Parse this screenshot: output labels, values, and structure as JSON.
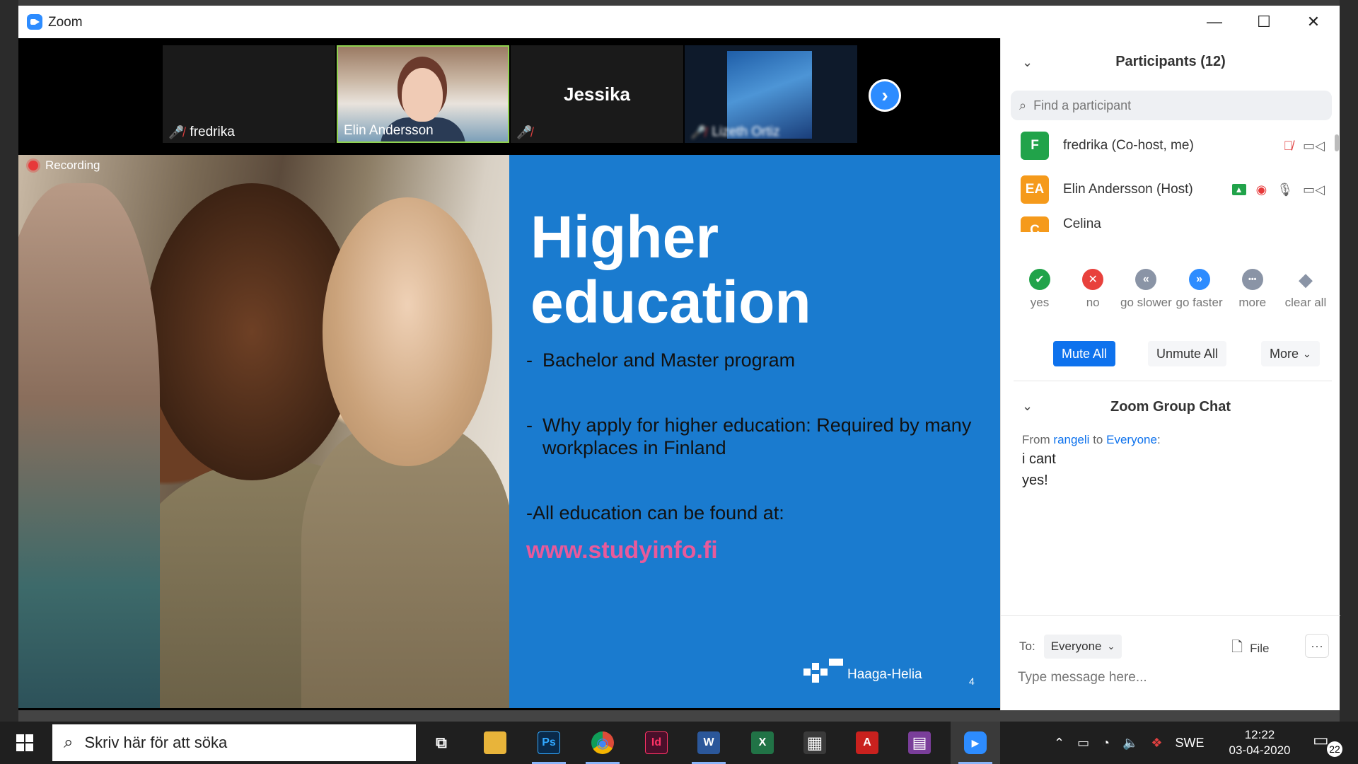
{
  "window": {
    "title": "Zoom"
  },
  "thumbnails": {
    "tiles": [
      {
        "name": "fredrika"
      },
      {
        "name": "Elin Andersson"
      },
      {
        "name": "Jessika"
      },
      {
        "name": "Lizeth Ortiz"
      }
    ]
  },
  "recording": {
    "label": "Recording"
  },
  "slide": {
    "title_line1": "Higher",
    "title_line2": "education",
    "bullets": [
      {
        "dash": "-",
        "text": "Bachelor and Master program"
      },
      {
        "dash": "-",
        "text": "Why apply for higher education: Required by many workplaces in Finland"
      },
      {
        "dash": "",
        "text": "-All education can be found at:"
      }
    ],
    "link": "www.studyinfo.fi",
    "logo_text": "Haaga-Helia",
    "page_number": "4",
    "accent_blue": "#1a7bcf",
    "link_color": "#e85a9b"
  },
  "participants": {
    "title": "Participants (12)",
    "search_placeholder": "Find a participant",
    "list": [
      {
        "initials": "F",
        "name": "fredrika (Co-host, me)",
        "color": "#21a34a"
      },
      {
        "initials": "EA",
        "name": "Elin Andersson (Host)",
        "color": "#f59a1b"
      },
      {
        "initials": "C",
        "name": "Celina",
        "color": "#f59a1b"
      }
    ],
    "reactions": [
      {
        "label": "yes",
        "glyph": "✔",
        "color": "#21a34a"
      },
      {
        "label": "no",
        "glyph": "✕",
        "color": "#e8413c"
      },
      {
        "label": "go slower",
        "glyph": "«",
        "color": "#8a94a6"
      },
      {
        "label": "go faster",
        "glyph": "»",
        "color": "#2d8cff"
      },
      {
        "label": "more",
        "glyph": "•••",
        "color": "#8a94a6"
      },
      {
        "label": "clear all",
        "glyph": "◆",
        "color": "#8a94a6"
      }
    ],
    "mute_all": "Mute All",
    "unmute_all": "Unmute All",
    "more": "More"
  },
  "chat": {
    "title": "Zoom Group Chat",
    "from_prefix": "From",
    "from_name": "rangeli",
    "to_word": "to",
    "to_name": "Everyone",
    "colon": ":",
    "messages": [
      "i cant",
      "yes!"
    ],
    "to_label": "To:",
    "to_value": "Everyone",
    "file_label": "File",
    "input_placeholder": "Type message here..."
  },
  "taskbar": {
    "search_text": "Skriv här för att söka",
    "apps": [
      {
        "name": "Task View",
        "glyph": "⧉",
        "color": "#1f1f1f"
      },
      {
        "name": "File Explorer",
        "glyph": "▬",
        "color": "#e8b43a"
      },
      {
        "name": "Photoshop",
        "glyph": "Ps",
        "color": "#0a2a4a"
      },
      {
        "name": "Chrome",
        "glyph": "◉",
        "color": "#dd4b39"
      },
      {
        "name": "InDesign",
        "glyph": "Id",
        "color": "#4a0f2a"
      },
      {
        "name": "Word",
        "glyph": "W",
        "color": "#2b579a"
      },
      {
        "name": "Excel",
        "glyph": "X",
        "color": "#217346"
      },
      {
        "name": "Calculator",
        "glyph": "▦",
        "color": "#3a3a3a"
      },
      {
        "name": "Acrobat",
        "glyph": "A",
        "color": "#c9211e"
      },
      {
        "name": "WinRAR",
        "glyph": "▤",
        "color": "#7a3e9a"
      },
      {
        "name": "Zoom",
        "glyph": "▶",
        "color": "#2d8cff"
      }
    ],
    "language": "SWE",
    "time": "12:22",
    "date": "03-04-2020",
    "notifications": "22"
  }
}
